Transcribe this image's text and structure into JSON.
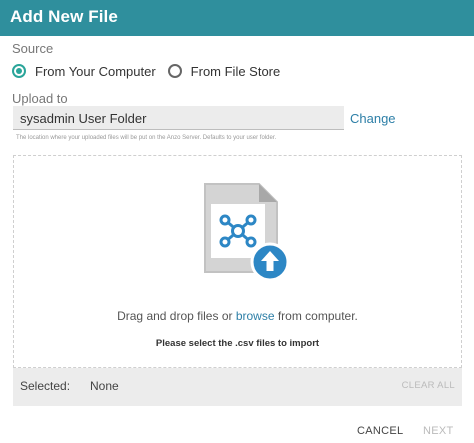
{
  "dialog": {
    "title": "Add New File"
  },
  "source": {
    "label": "Source",
    "options": [
      {
        "label": "From Your Computer",
        "selected": true
      },
      {
        "label": "From File Store",
        "selected": false
      }
    ]
  },
  "upload_to": {
    "label": "Upload to",
    "value": "sysadmin User Folder",
    "change_label": "Change",
    "help_text": "The location where your uploaded files will be put on the Anzo Server. Defaults to your user folder."
  },
  "dropzone": {
    "text_before": "Drag and drop files or ",
    "browse_label": "browse",
    "text_after": " from computer.",
    "instruction": "Please select the .csv files to import",
    "icon": "file-upload-icon"
  },
  "selection": {
    "label": "Selected:",
    "value": "None",
    "clear_all_label": "CLEAR ALL"
  },
  "footer": {
    "cancel_label": "CANCEL",
    "next_label": "NEXT"
  },
  "colors": {
    "header": "#2f8f9d",
    "accent": "#2aa59a",
    "link": "#2d7fa7",
    "upload_badge": "#2d87c5"
  }
}
